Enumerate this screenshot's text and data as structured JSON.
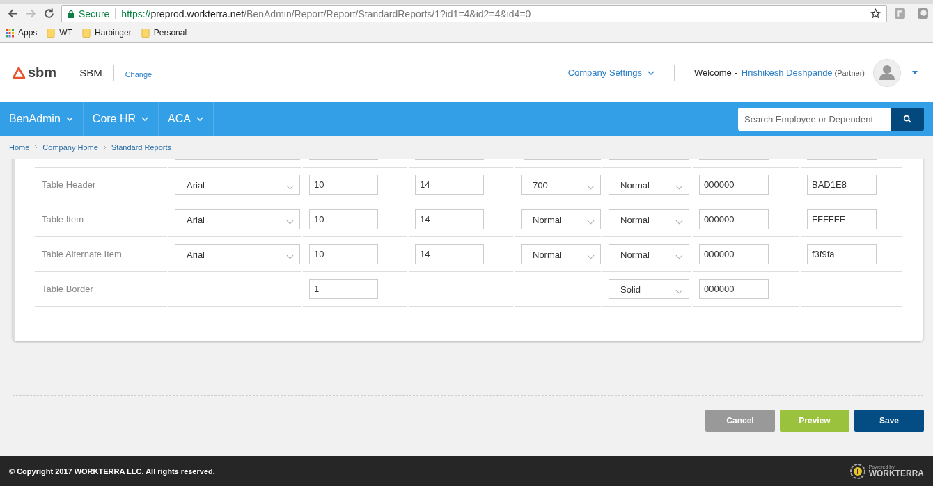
{
  "browser": {
    "back_enabled": true,
    "forward_enabled": false,
    "security": "Secure",
    "url_scheme": "https://",
    "url_host": "preprod.workterra.net",
    "url_path": "/BenAdmin/Report/Report/StandardReports/1?id1=4&id2=4&id4=0",
    "bookmarks": [
      {
        "kind": "apps",
        "label": "Apps"
      },
      {
        "kind": "folder",
        "label": "WT"
      },
      {
        "kind": "folder",
        "label": "Harbinger"
      },
      {
        "kind": "folder",
        "label": "Personal"
      }
    ]
  },
  "header": {
    "logo_text": "sbm",
    "company": "SBM",
    "change_link": "Change",
    "settings_menu": "Company Settings",
    "welcome": "Welcome -",
    "user_name": "Hrishikesh Deshpande",
    "user_role": "(Partner)"
  },
  "nav": {
    "items": [
      {
        "label": "BenAdmin"
      },
      {
        "label": "Core HR"
      },
      {
        "label": "ACA"
      }
    ],
    "search_placeholder": "Search Employee or Dependent"
  },
  "breadcrumb": [
    "Home",
    "Company Home",
    "Standard Reports"
  ],
  "rows": [
    {
      "label": "Table Header",
      "cells": [
        {
          "kind": "select",
          "value": "Arial"
        },
        {
          "kind": "input",
          "value": "10"
        },
        {
          "kind": "input",
          "value": "14"
        },
        {
          "kind": "select",
          "value": "700"
        },
        {
          "kind": "select",
          "value": "Normal"
        },
        {
          "kind": "input",
          "value": "000000"
        },
        {
          "kind": "input",
          "value": "BAD1E8"
        }
      ]
    },
    {
      "label": "Table Item",
      "cells": [
        {
          "kind": "select",
          "value": "Arial"
        },
        {
          "kind": "input",
          "value": "10"
        },
        {
          "kind": "input",
          "value": "14"
        },
        {
          "kind": "select",
          "value": "Normal"
        },
        {
          "kind": "select",
          "value": "Normal"
        },
        {
          "kind": "input",
          "value": "000000"
        },
        {
          "kind": "input",
          "value": "FFFFFF"
        }
      ]
    },
    {
      "label": "Table Alternate Item",
      "cells": [
        {
          "kind": "select",
          "value": "Arial"
        },
        {
          "kind": "input",
          "value": "10"
        },
        {
          "kind": "input",
          "value": "14"
        },
        {
          "kind": "select",
          "value": "Normal"
        },
        {
          "kind": "select",
          "value": "Normal"
        },
        {
          "kind": "input",
          "value": "000000"
        },
        {
          "kind": "input",
          "value": "f3f9fa"
        }
      ]
    },
    {
      "label": "Table Border",
      "cells": [
        {
          "kind": "empty"
        },
        {
          "kind": "input",
          "value": "1"
        },
        {
          "kind": "empty"
        },
        {
          "kind": "empty"
        },
        {
          "kind": "select",
          "value": "Solid"
        },
        {
          "kind": "input",
          "value": "000000"
        },
        {
          "kind": "empty"
        }
      ]
    }
  ],
  "buttons": [
    {
      "kind": "cancel",
      "label": "Cancel"
    },
    {
      "kind": "preview",
      "label": "Preview"
    },
    {
      "kind": "save",
      "label": "Save"
    }
  ],
  "footer": {
    "copyright": "© Copyright 2017 WORKTERRA LLC. All rights reserved.",
    "powered_by": "Powered by",
    "brand": "WORKTERRA"
  }
}
